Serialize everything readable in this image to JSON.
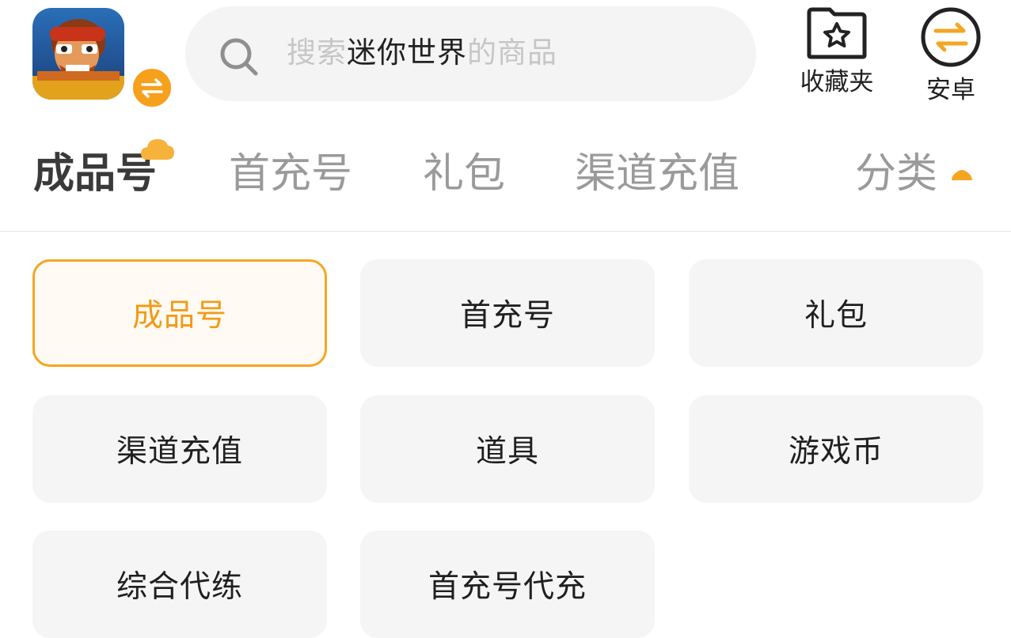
{
  "header": {
    "app_icon": "game-app-icon",
    "switch_icon": "swap-arrows-icon",
    "search": {
      "prefix": "搜索",
      "keyword": "迷你世界",
      "suffix": "的商品",
      "icon": "search-icon"
    },
    "favorites": {
      "label": "收藏夹",
      "icon": "star-folder-icon"
    },
    "platform": {
      "label": "安卓",
      "icon": "swap-circle-icon"
    }
  },
  "tabs": [
    {
      "label": "成品号",
      "active": true
    },
    {
      "label": "首充号",
      "active": false
    },
    {
      "label": "礼包",
      "active": false
    },
    {
      "label": "渠道充值",
      "active": false
    }
  ],
  "category_toggle": {
    "label": "分类",
    "icon": "caret-up-icon"
  },
  "categories": [
    {
      "label": "成品号",
      "selected": true
    },
    {
      "label": "首充号",
      "selected": false
    },
    {
      "label": "礼包",
      "selected": false
    },
    {
      "label": "渠道充值",
      "selected": false
    },
    {
      "label": "道具",
      "selected": false
    },
    {
      "label": "游戏币",
      "selected": false
    },
    {
      "label": "综合代练",
      "selected": false
    },
    {
      "label": "首充号代充",
      "selected": false
    }
  ],
  "colors": {
    "accent": "#f4a623",
    "accent_text": "#f29a16",
    "tab_inactive": "#9a9a9a",
    "chip_bg": "#f5f5f5"
  }
}
